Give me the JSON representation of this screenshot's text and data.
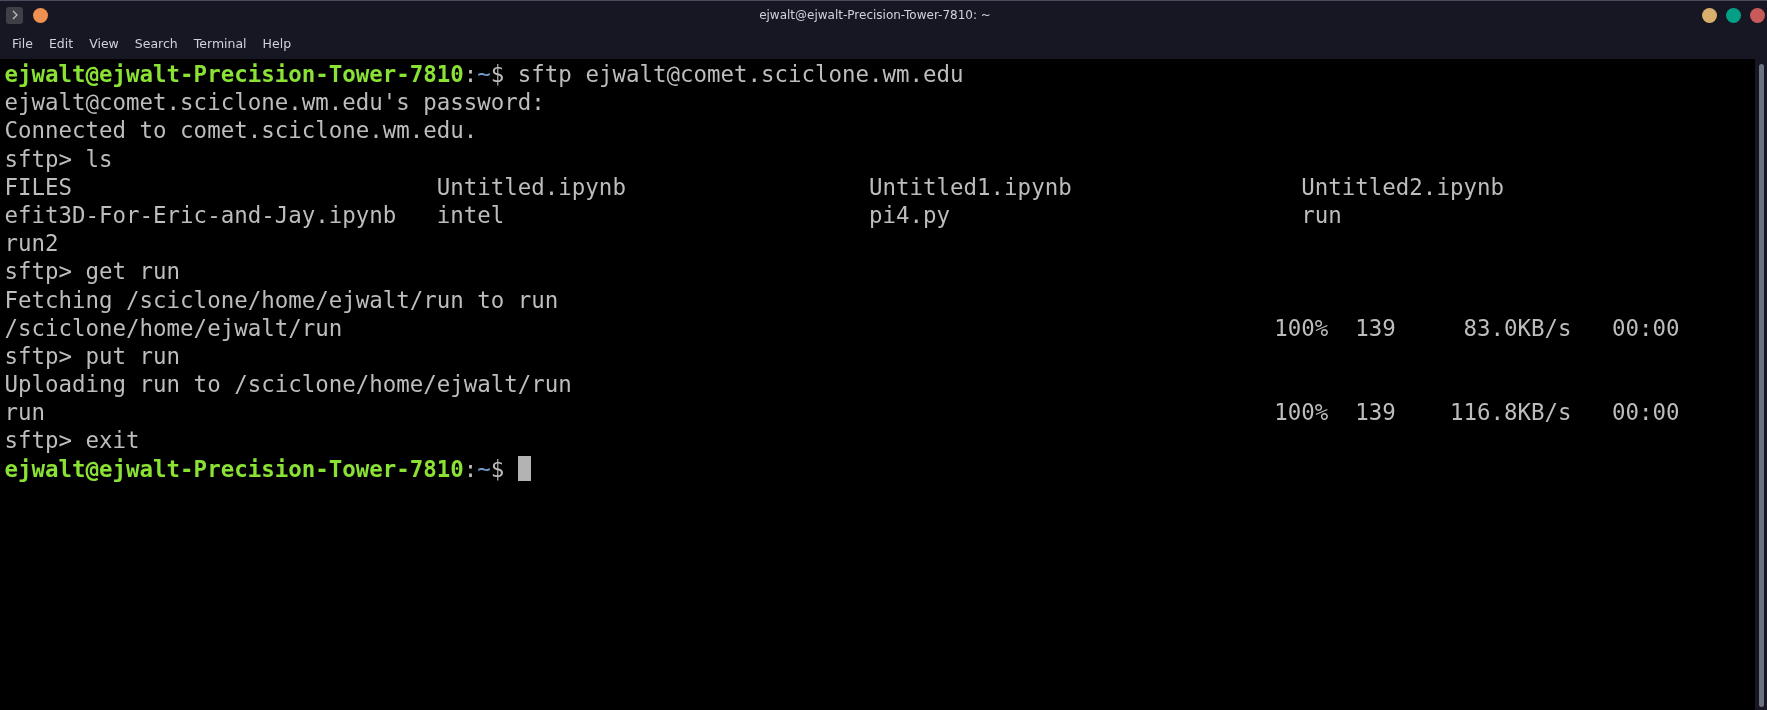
{
  "window": {
    "title": "ejwalt@ejwalt-Precision-Tower-7810: ~",
    "left_controls": [
      {
        "kind": "menu"
      },
      {
        "kind": "dot",
        "color": "#ee9150"
      }
    ],
    "right_controls": [
      {
        "kind": "dot",
        "color": "#d8b06c"
      },
      {
        "kind": "dot",
        "color": "#059f86"
      },
      {
        "kind": "dot",
        "color": "#c95a5a"
      }
    ]
  },
  "menu": [
    "File",
    "Edit",
    "View",
    "Search",
    "Terminal",
    "Help"
  ],
  "terminal": {
    "lines": [
      {
        "kind": "prompt",
        "user": "ejwalt@ejwalt-Precision-Tower-7810",
        "colon": ":",
        "dir": "~",
        "sign": "$",
        "command": "sftp ejwalt@comet.sciclone.wm.edu",
        "cursor": false
      },
      {
        "kind": "text",
        "text": "ejwalt@comet.sciclone.wm.edu's password:"
      },
      {
        "kind": "text",
        "text": "Connected to comet.sciclone.wm.edu."
      },
      {
        "kind": "text",
        "text": "sftp> ls"
      },
      {
        "kind": "columns",
        "cells": [
          "FILES",
          "Untitled.ipynb",
          "Untitled1.ipynb",
          "Untitled2.ipynb"
        ]
      },
      {
        "kind": "columns",
        "cells": [
          "efit3D-For-Eric-and-Jay.ipynb",
          "intel",
          "pi4.py",
          "run"
        ]
      },
      {
        "kind": "columns",
        "cells": [
          "run2"
        ]
      },
      {
        "kind": "text",
        "text": "sftp> get run"
      },
      {
        "kind": "text",
        "text": "Fetching /sciclone/home/ejwalt/run to run"
      },
      {
        "kind": "transfer",
        "name": "/sciclone/home/ejwalt/run",
        "percent": "100%",
        "size": "139",
        "rate": "83.0KB/s",
        "eta": "00:00"
      },
      {
        "kind": "text",
        "text": "sftp> put run"
      },
      {
        "kind": "text",
        "text": "Uploading run to /sciclone/home/ejwalt/run"
      },
      {
        "kind": "transfer",
        "name": "run",
        "percent": "100%",
        "size": "139",
        "rate": "116.8KB/s",
        "eta": "00:00"
      },
      {
        "kind": "text",
        "text": "sftp> exit"
      },
      {
        "kind": "prompt",
        "user": "ejwalt@ejwalt-Precision-Tower-7810",
        "colon": ":",
        "dir": "~",
        "sign": "$",
        "cursor": true
      }
    ]
  }
}
